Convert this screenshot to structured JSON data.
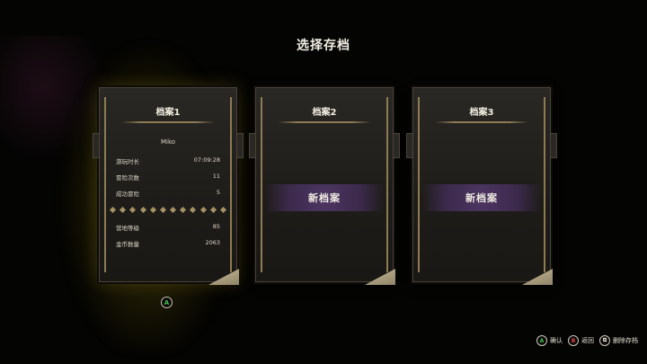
{
  "screen_title": "选择存档",
  "slots": [
    {
      "title": "档案1",
      "player_name": "Miko",
      "stats_top": [
        {
          "label": "游玩时长",
          "value": "07:09:28"
        },
        {
          "label": "冒险次数",
          "value": "11"
        },
        {
          "label": "成功冒险",
          "value": "5"
        }
      ],
      "stats_bottom": [
        {
          "label": "营地等级",
          "value": "85"
        },
        {
          "label": "金币数量",
          "value": "2063"
        }
      ],
      "selected": true
    },
    {
      "title": "档案2",
      "new_label": "新档案"
    },
    {
      "title": "档案3",
      "new_label": "新档案"
    }
  ],
  "selected_prompt_button": "A",
  "footer": {
    "confirm": {
      "button": "A",
      "label": "确认"
    },
    "back": {
      "button": "B",
      "label": "返回"
    },
    "delete": {
      "button": "⧉",
      "label": "删除存档"
    }
  },
  "colors": {
    "accent_gold": "#8d7b53",
    "new_file_band": "#4a3560",
    "a_button": "#43c24b",
    "b_button": "#e04040"
  }
}
